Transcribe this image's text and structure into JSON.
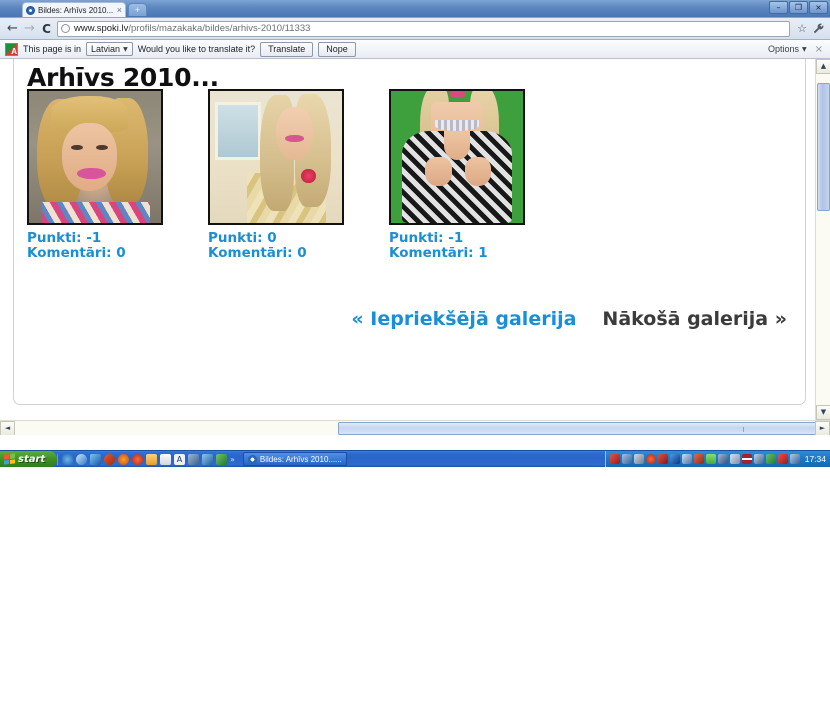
{
  "browser": {
    "tab": {
      "title": "Bildes: Arhīvs 2010...",
      "close_label": "×",
      "favicon": "globe-icon"
    },
    "new_tab_label": "+",
    "window_controls": {
      "minimize": "–",
      "restore": "❐",
      "close": "×"
    },
    "toolbar": {
      "back_label": "←",
      "forward_label": "→",
      "reload_label": "C",
      "url_host": "www.spoki.lv",
      "url_path": "/profils/mazakaka/bildes/arhivs-2010/11333",
      "url_full": "www.spoki.lv/profils/mazakaka/bildes/arhivs-2010/11333",
      "bookmark_label": "☆",
      "wrench_label": "🔧"
    },
    "infobar": {
      "prompt_prefix": "This page is in",
      "language": "Latvian",
      "prompt_suffix": "Would you like to translate it?",
      "translate_label": "Translate",
      "decline_label": "Nope",
      "options_label": "Options",
      "close_label": "×"
    }
  },
  "page": {
    "title": "Arhīvs 2010...",
    "photos": [
      {
        "points_label": "Punkti: -1",
        "comments_label": "Komentāri: 0",
        "alt": "blonde-woman-portrait-thumbnail"
      },
      {
        "points_label": "Punkti: 0",
        "comments_label": "Komentāri: 0",
        "alt": "blonde-woman-indoor-thumbnail"
      },
      {
        "points_label": "Punkti: -1",
        "comments_label": "Komentāri: 1",
        "alt": "blonde-woman-green-background-thumbnail"
      }
    ],
    "nav": {
      "prev_label": "« Iepriekšējā galerija",
      "next_label": "Nākošā galerija »",
      "prev_color": "#1b8fd4",
      "next_color": "#3b3b3b"
    },
    "link_color": "#1b8fd4"
  },
  "scrollbars": {
    "vertical": {
      "up_label": "▲",
      "down_label": "▼"
    },
    "horizontal": {
      "left_label": "◄",
      "right_label": "►"
    }
  },
  "taskbar": {
    "start_label": "start",
    "quicklaunch_overflow": "»",
    "window_button": {
      "label": "Bildes: Arhīvs 2010......"
    },
    "clock": "17:34"
  }
}
